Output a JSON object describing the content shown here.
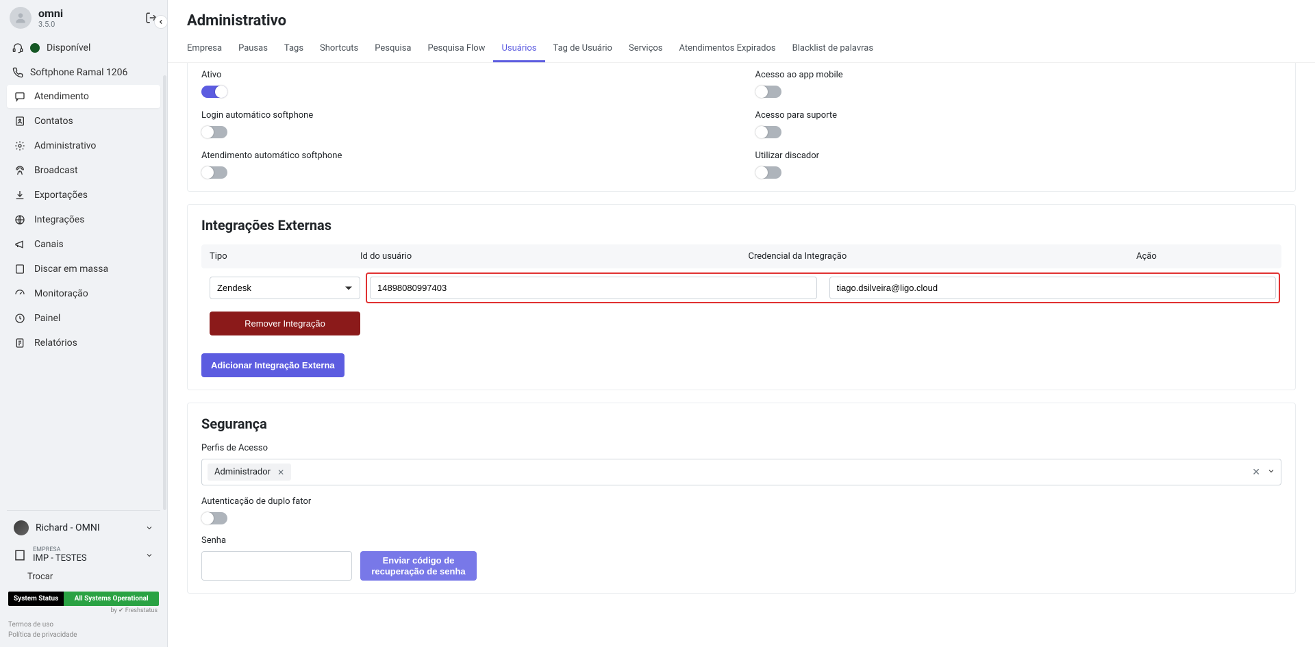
{
  "sidebar": {
    "appName": "omni",
    "version": "3.5.0",
    "status": "Disponível",
    "softphone": "Softphone Ramal 1206",
    "nav": [
      {
        "label": "Atendimento",
        "active": true
      },
      {
        "label": "Contatos"
      },
      {
        "label": "Administrativo"
      },
      {
        "label": "Broadcast"
      },
      {
        "label": "Exportações"
      },
      {
        "label": "Integrações"
      },
      {
        "label": "Canais"
      },
      {
        "label": "Discar em massa"
      },
      {
        "label": "Monitoração"
      },
      {
        "label": "Painel"
      },
      {
        "label": "Relatórios"
      }
    ],
    "user": "Richard - OMNI",
    "companyLabel": "EMPRESA",
    "companyName": "IMP - TESTES",
    "swap": "Trocar",
    "statusBadgeLeft": "System Status",
    "statusBadgeRight": "All Systems Operational",
    "byFresh": "by ✔ Freshstatus",
    "terms": "Termos de uso",
    "privacy": "Política de privacidade"
  },
  "page": {
    "title": "Administrativo",
    "tabs": [
      "Empresa",
      "Pausas",
      "Tags",
      "Shortcuts",
      "Pesquisa",
      "Pesquisa Flow",
      "Usuários",
      "Tag de Usuário",
      "Serviços",
      "Atendimentos Expirados",
      "Blacklist de palavras"
    ],
    "activeTab": 6
  },
  "topSettings": {
    "left": [
      {
        "label": "Ativo",
        "on": true
      },
      {
        "label": "Login automático softphone",
        "on": false
      },
      {
        "label": "Atendimento automático softphone",
        "on": false
      }
    ],
    "right": [
      {
        "label": "Acesso ao app mobile",
        "on": false
      },
      {
        "label": "Acesso para suporte",
        "on": false
      },
      {
        "label": "Utilizar discador",
        "on": false
      }
    ]
  },
  "integrations": {
    "title": "Integrações Externas",
    "headers": {
      "tipo": "Tipo",
      "id": "Id do usuário",
      "cred": "Credencial da Integração",
      "acao": "Ação"
    },
    "row": {
      "tipo": "Zendesk",
      "id": "14898080997403",
      "cred": "tiago.dsilveira@ligo.cloud"
    },
    "removeBtn": "Remover Integração",
    "addBtn": "Adicionar Integração Externa"
  },
  "security": {
    "title": "Segurança",
    "profilesLabel": "Perfis de Acesso",
    "profileChip": "Administrador",
    "twofaLabel": "Autenticação de duplo fator",
    "passwordLabel": "Senha",
    "sendBtn": "Enviar código de recuperação de senha"
  }
}
